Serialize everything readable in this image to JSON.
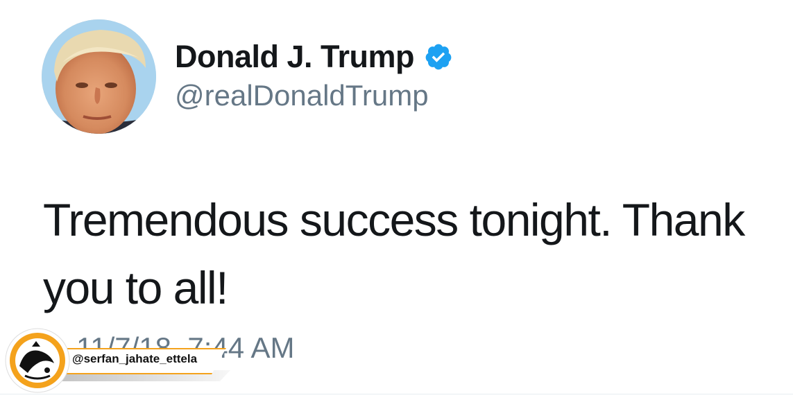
{
  "author": {
    "display_name": "Donald J. Trump",
    "handle": "@realDonaldTrump",
    "verified": true,
    "verified_icon": "verified-badge-icon",
    "verified_color": "#1da1f2"
  },
  "tweet": {
    "text_line_1": "Tremendous success tonight. Thank",
    "text_line_2": "you to all!",
    "timestamp": "11/7/18, 7:44 AM"
  },
  "watermark": {
    "handle": "@serfan_jahate_ettela",
    "logo_icon": "channel-logo-icon",
    "accent_color": "#f4a21c"
  },
  "colors": {
    "text": "#14171a",
    "secondary_text": "#657786",
    "background": "#ffffff"
  }
}
